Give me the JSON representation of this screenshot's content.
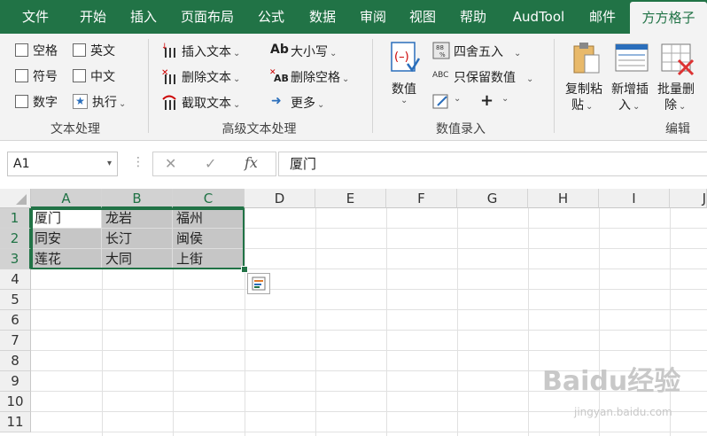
{
  "tabs": [
    {
      "label": "文件",
      "active": false
    },
    {
      "label": "开始",
      "active": false
    },
    {
      "label": "插入",
      "active": false
    },
    {
      "label": "页面布局",
      "active": false
    },
    {
      "label": "公式",
      "active": false
    },
    {
      "label": "数据",
      "active": false
    },
    {
      "label": "审阅",
      "active": false
    },
    {
      "label": "视图",
      "active": false
    },
    {
      "label": "帮助",
      "active": false
    },
    {
      "label": "AudTool",
      "active": false
    },
    {
      "label": "邮件",
      "active": false
    },
    {
      "label": "方方格子",
      "active": true
    }
  ],
  "ribbon": {
    "text_group": {
      "label": "文本处理",
      "checks": [
        "空格",
        "英文",
        "符号",
        "中文",
        "数字"
      ],
      "execute": "执行"
    },
    "adv_group": {
      "label": "高级文本处理",
      "insert": "插入文本",
      "delete": "删除文本",
      "extract": "截取文本",
      "case": "大小写",
      "remove_space": "删除空格",
      "more": "更多"
    },
    "num_group": {
      "label": "数值录入",
      "value": "数值",
      "round": "四舍五入",
      "keep_value": "只保留数值",
      "plus": "+"
    },
    "edit_group": {
      "label": "编辑",
      "copy_paste_1": "复制粘",
      "copy_paste_2": "贴",
      "new_insert_1": "新增插",
      "new_insert_2": "入",
      "batch_delete_1": "批量删",
      "batch_delete_2": "除"
    }
  },
  "formula_bar": {
    "name_box": "A1",
    "cancel": "✕",
    "confirm": "✓",
    "fx": "fx",
    "content": "厦门"
  },
  "columns": [
    "A",
    "B",
    "C",
    "D",
    "E",
    "F",
    "G",
    "H",
    "I",
    "J"
  ],
  "rows": [
    "1",
    "2",
    "3",
    "4",
    "5",
    "6",
    "7",
    "8",
    "9",
    "10",
    "11"
  ],
  "cells": [
    [
      "厦门",
      "龙岩",
      "福州"
    ],
    [
      "同安",
      "长汀",
      "闽侯"
    ],
    [
      "莲花",
      "大同",
      "上街"
    ]
  ],
  "watermark": {
    "brand": "Baidu经验",
    "url": "jingyan.baidu.com"
  }
}
